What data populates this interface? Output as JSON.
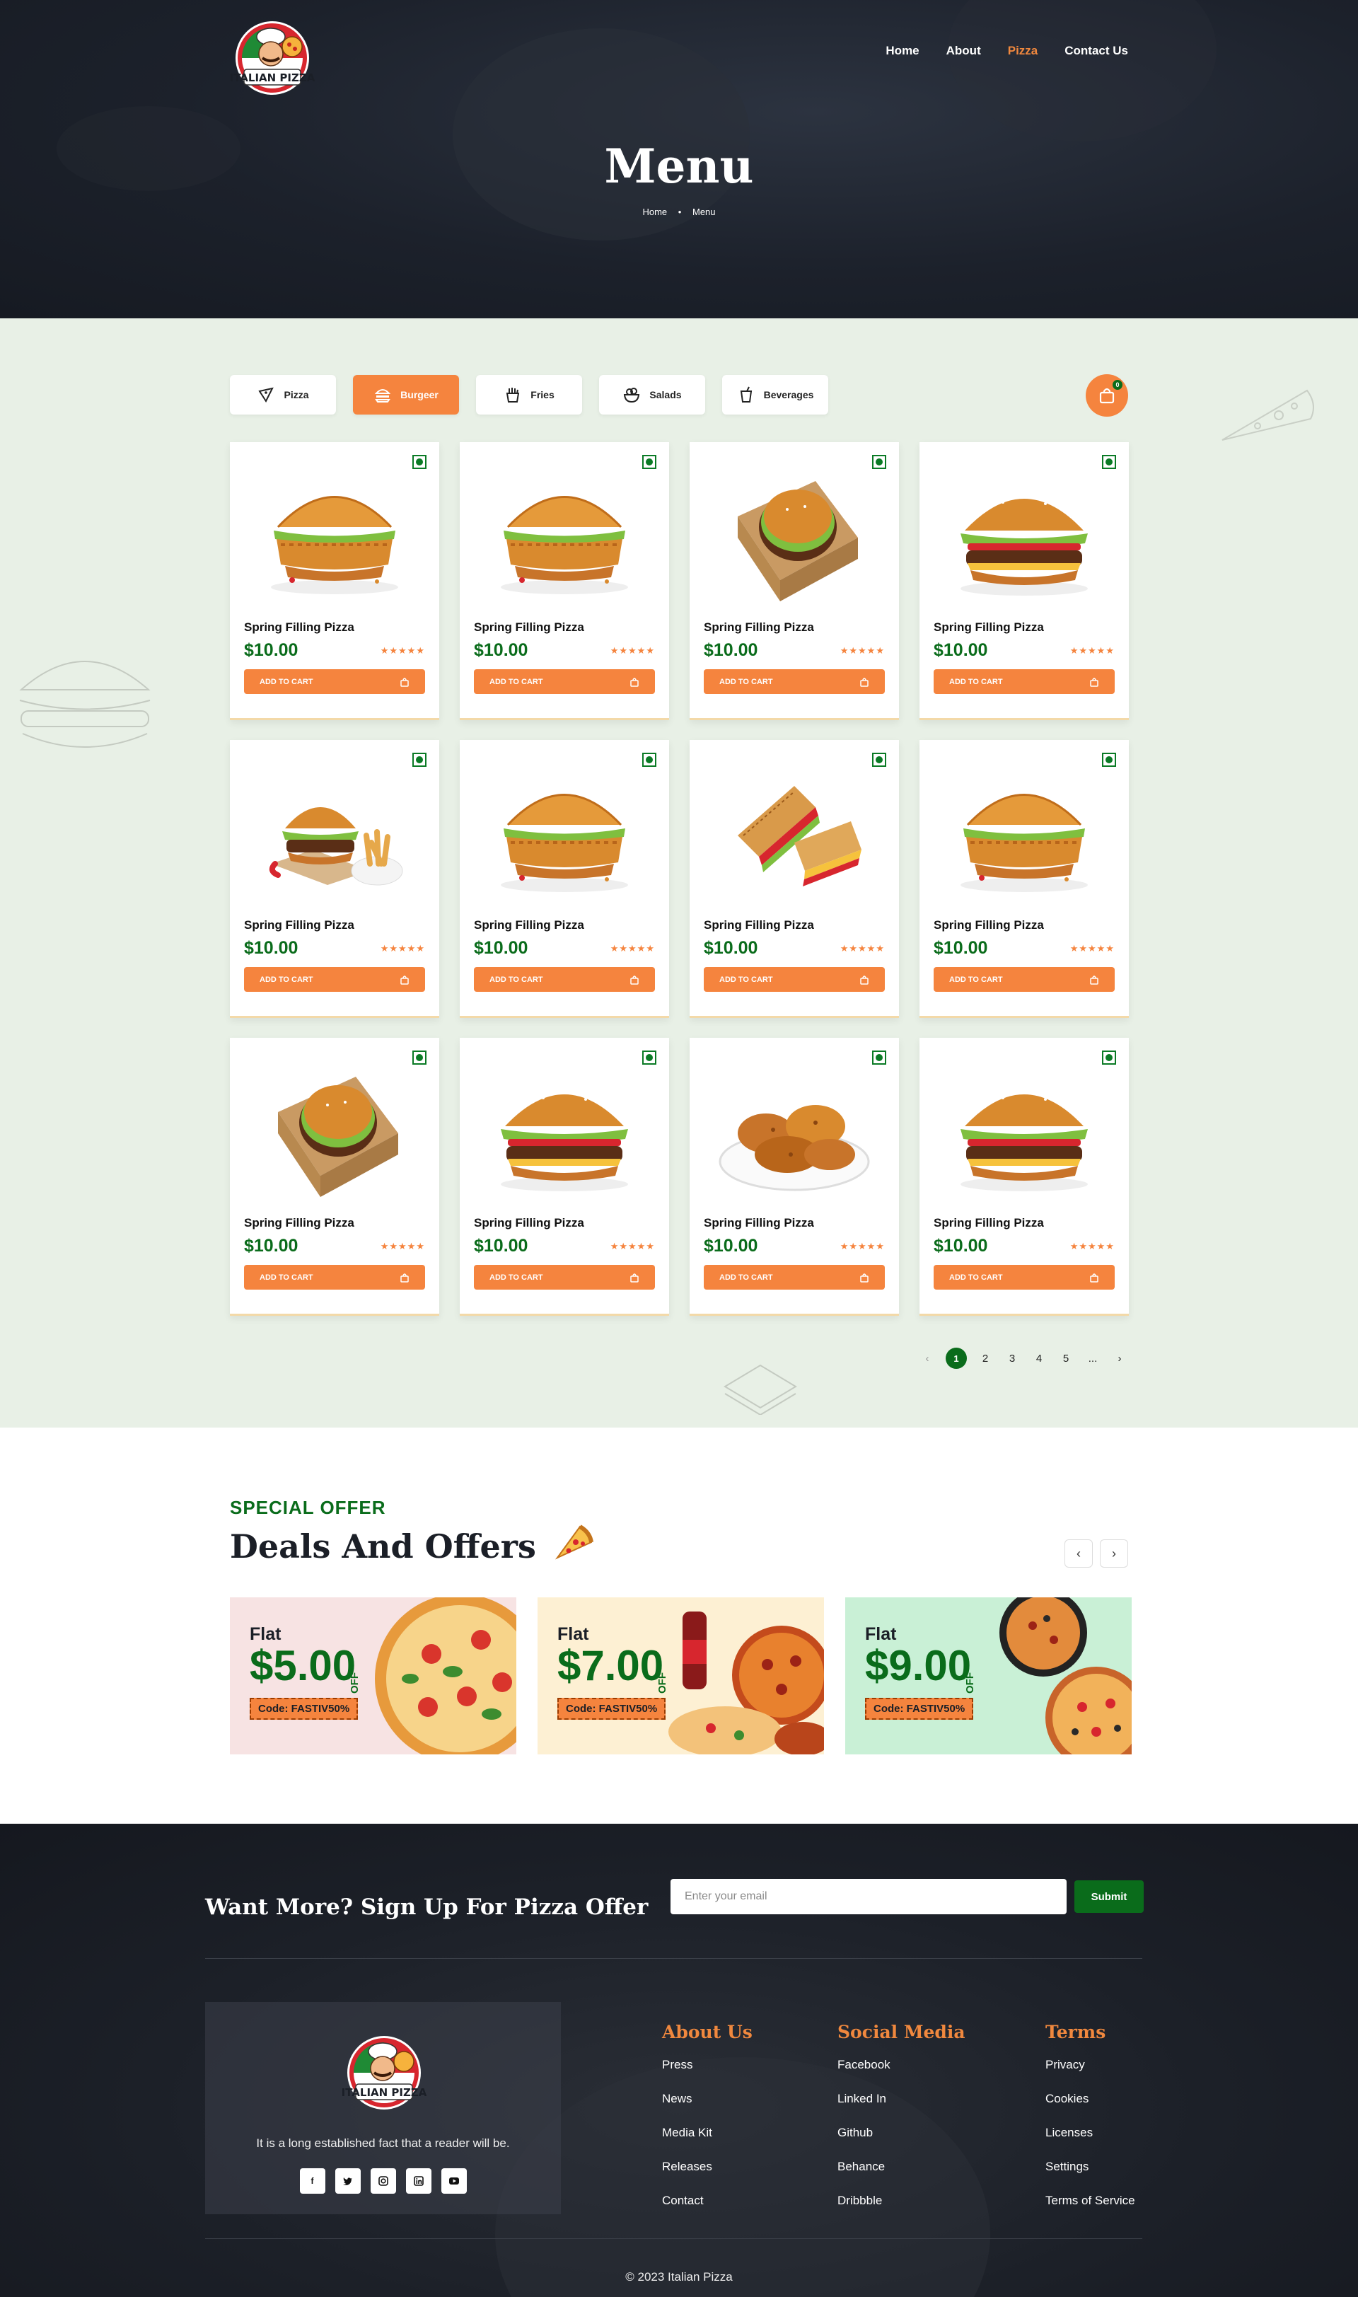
{
  "nav": {
    "items": [
      {
        "label": "Home",
        "active": false
      },
      {
        "label": "About",
        "active": false
      },
      {
        "label": "Pizza",
        "active": true
      },
      {
        "label": "Contact Us",
        "active": false
      }
    ]
  },
  "hero": {
    "title": "Menu",
    "breadcrumb": [
      "Home",
      "Menu"
    ]
  },
  "logo": {
    "text": "ITALIAN PIZZA"
  },
  "tabs": [
    {
      "label": "Pizza",
      "icon": "pizza-slice-icon",
      "active": false
    },
    {
      "label": "Burgeer",
      "icon": "burger-icon",
      "active": true
    },
    {
      "label": "Fries",
      "icon": "fries-icon",
      "active": false
    },
    {
      "label": "Salads",
      "icon": "salad-bowl-icon",
      "active": false
    },
    {
      "label": "Beverages",
      "icon": "beverage-cup-icon",
      "active": false
    }
  ],
  "cart": {
    "count": "0",
    "icon": "shopping-bag-icon"
  },
  "products": [
    {
      "name": "Spring Filling Pizza",
      "price": "$10.00",
      "stars": "★★★★★",
      "button": "ADD TO CART",
      "image": "crispy-chicken-burger"
    },
    {
      "name": "Spring Filling Pizza",
      "price": "$10.00",
      "stars": "★★★★★",
      "button": "ADD TO CART",
      "image": "crispy-chicken-burger"
    },
    {
      "name": "Spring Filling Pizza",
      "price": "$10.00",
      "stars": "★★★★★",
      "button": "ADD TO CART",
      "image": "burger-in-box"
    },
    {
      "name": "Spring Filling Pizza",
      "price": "$10.00",
      "stars": "★★★★★",
      "button": "ADD TO CART",
      "image": "beef-burger"
    },
    {
      "name": "Spring Filling Pizza",
      "price": "$10.00",
      "stars": "★★★★★",
      "button": "ADD TO CART",
      "image": "burger-with-fries"
    },
    {
      "name": "Spring Filling Pizza",
      "price": "$10.00",
      "stars": "★★★★★",
      "button": "ADD TO CART",
      "image": "crispy-chicken-burger"
    },
    {
      "name": "Spring Filling Pizza",
      "price": "$10.00",
      "stars": "★★★★★",
      "button": "ADD TO CART",
      "image": "grilled-sandwich"
    },
    {
      "name": "Spring Filling Pizza",
      "price": "$10.00",
      "stars": "★★★★★",
      "button": "ADD TO CART",
      "image": "crispy-chicken-burger"
    },
    {
      "name": "Spring Filling Pizza",
      "price": "$10.00",
      "stars": "★★★★★",
      "button": "ADD TO CART",
      "image": "burger-in-box"
    },
    {
      "name": "Spring Filling Pizza",
      "price": "$10.00",
      "stars": "★★★★★",
      "button": "ADD TO CART",
      "image": "beef-burger"
    },
    {
      "name": "Spring Filling Pizza",
      "price": "$10.00",
      "stars": "★★★★★",
      "button": "ADD TO CART",
      "image": "fried-chicken"
    },
    {
      "name": "Spring Filling Pizza",
      "price": "$10.00",
      "stars": "★★★★★",
      "button": "ADD TO CART",
      "image": "beef-burger"
    }
  ],
  "pagination": {
    "prev": "‹",
    "pages": [
      "1",
      "2",
      "3",
      "4",
      "5",
      "..."
    ],
    "current": "1",
    "next": "›"
  },
  "offers": {
    "kicker": "SPECIAL OFFER",
    "title": "Deals And Offers",
    "prev": "‹",
    "next": "›",
    "cards": [
      {
        "flat": "Flat",
        "amount": "$5.00",
        "off": "OFF",
        "code": "Code: FASTIV50%",
        "bg": "#f7e3e3"
      },
      {
        "flat": "Flat",
        "amount": "$7.00",
        "off": "OFF",
        "code": "Code: FASTIV50%",
        "bg": "#fdf0d3"
      },
      {
        "flat": "Flat",
        "amount": "$9.00",
        "off": "OFF",
        "code": "Code: FASTIV50%",
        "bg": "#c9f0d6"
      }
    ]
  },
  "footer": {
    "signup_title": "Want More? Sign Up For Pizza Offer",
    "email_placeholder": "Enter your email",
    "submit": "Submit",
    "about_text": "It is a long established fact that a reader will be.",
    "socials": [
      "facebook-icon",
      "twitter-icon",
      "instagram-icon",
      "linkedin-icon",
      "youtube-icon"
    ],
    "columns": [
      {
        "title": "About Us",
        "links": [
          "Press",
          "News",
          "Media Kit",
          "Releases",
          "Contact"
        ]
      },
      {
        "title": "Social Media",
        "links": [
          "Facebook",
          "Linked In",
          "Github",
          "Behance",
          "Dribbble"
        ]
      },
      {
        "title": "Terms",
        "links": [
          "Privacy",
          "Cookies",
          "Licenses",
          "Settings",
          "Terms of Service"
        ]
      }
    ],
    "copyright": "© 2023 Italian Pizza"
  },
  "colors": {
    "accent": "#f5843e",
    "green": "#0a6c1b",
    "dark": "#1c212b",
    "menu_bg": "#e8f0e6"
  }
}
